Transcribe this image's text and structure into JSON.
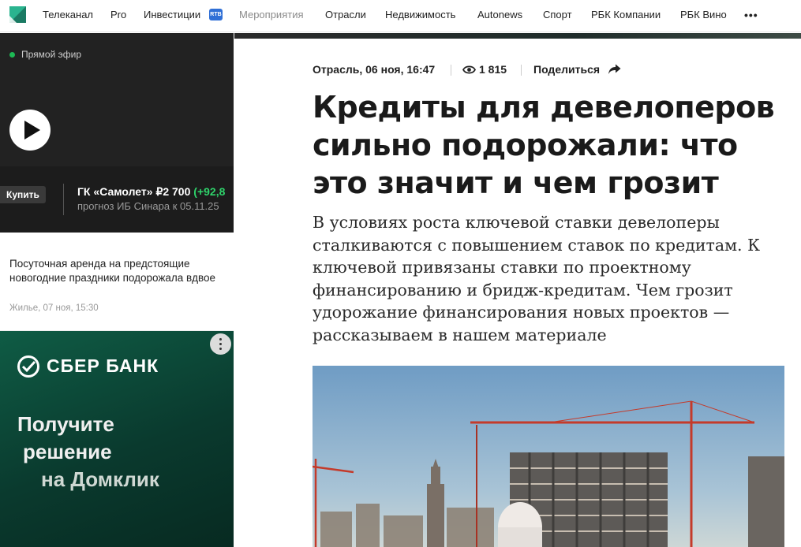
{
  "nav": {
    "items": [
      "Телеканал",
      "Pro",
      "Инвестиции",
      "Мероприятия",
      "Отрасли",
      "Недвижимость",
      "Autonews",
      "Спорт",
      "РБК Компании",
      "РБК Вино"
    ],
    "badge": "RTB",
    "more": "•••"
  },
  "live": {
    "label": "Прямой эфир"
  },
  "ticker": {
    "buy_label": "Купить",
    "name": "ГК «Самолет» ₽2 700",
    "change": "(+92,8",
    "forecast": "прогноз ИБ Синара к 05.11.25"
  },
  "side_news": {
    "title": "Посуточная аренда на предстоящие новогодние праздники подорожала вдвое",
    "meta": "Жилье, 07 ноя, 15:30"
  },
  "ad": {
    "brand": "СБЕР БАНК",
    "line1": "Получите",
    "line2": "решение",
    "line3": "на Домклик"
  },
  "article": {
    "date": "Отрасль, 06 ноя, 16:47",
    "views": "1 815",
    "share_label": "Поделиться",
    "headline": "Кредиты для девелоперов сильно подорожали: что это значит и чем грозит",
    "lead": "В условиях роста ключевой ставки девелоперы сталкиваются с повышением ставок по кредитам. К ключевой привязаны ставки по проектному финансированию и бридж-кредитам. Чем грозит удорожание финансирования новых проектов — рассказываем в нашем материале"
  },
  "colors": {
    "accent_green": "#1db954",
    "positive_change": "#2fd36b",
    "ad_background": "#0f5c45",
    "logo_teal": "#2ab48f"
  },
  "icons": [
    "rbc-logo-icon",
    "live-dot-icon",
    "play-icon",
    "eye-icon",
    "share-arrow-icon",
    "sber-check-icon",
    "more-dots-icon"
  ]
}
